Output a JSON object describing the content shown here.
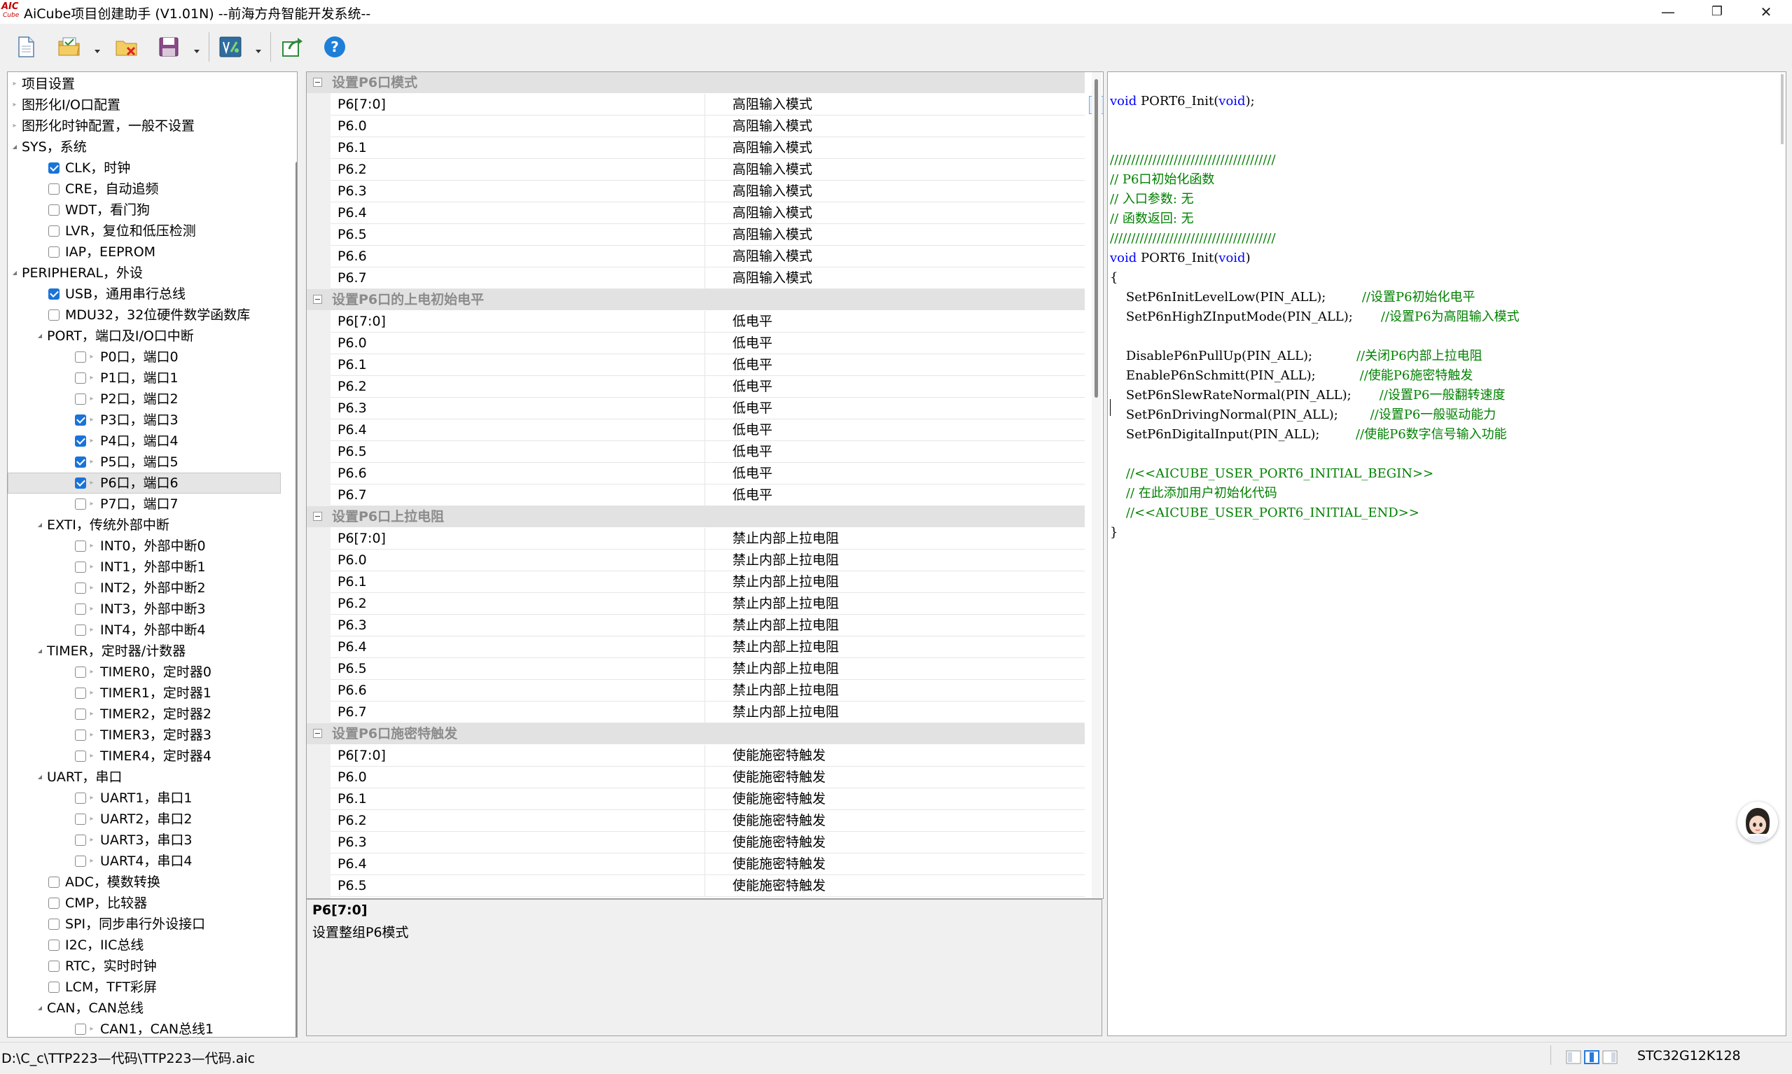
{
  "window": {
    "title": "AiCube项目创建助手 (V1.01N)   --前海方舟智能开发系统--",
    "logo_top": "AIC",
    "logo_bottom": "Cube",
    "controls": [
      "—",
      "❐",
      "✕"
    ]
  },
  "toolbar": {
    "buttons": [
      "new-project-icon",
      "open-project-icon",
      "close-project-icon",
      "save-icon",
      "generate-code-icon",
      "export-icon",
      "help-icon"
    ],
    "help_label": "?"
  },
  "tree": {
    "items": [
      {
        "label": "项目设置",
        "level": 0,
        "kind": "leaf",
        "checkbox": null
      },
      {
        "label": "图形化I/O口配置",
        "level": 0,
        "kind": "leaf",
        "checkbox": null
      },
      {
        "label": "图形化时钟配置，一般不设置",
        "level": 0,
        "kind": "leaf",
        "checkbox": null
      },
      {
        "label": "SYS，系统",
        "level": 0,
        "kind": "expanded",
        "checkbox": null
      },
      {
        "label": "CLK，时钟",
        "level": 1,
        "kind": "none",
        "checkbox": true
      },
      {
        "label": "CRE，自动追频",
        "level": 1,
        "kind": "none",
        "checkbox": false
      },
      {
        "label": "WDT，看门狗",
        "level": 1,
        "kind": "none",
        "checkbox": false
      },
      {
        "label": "LVR，复位和低压检测",
        "level": 1,
        "kind": "none",
        "checkbox": false
      },
      {
        "label": "IAP，EEPROM",
        "level": 1,
        "kind": "none",
        "checkbox": false
      },
      {
        "label": "PERIPHERAL，外设",
        "level": 0,
        "kind": "expanded",
        "checkbox": null
      },
      {
        "label": "USB，通用串行总线",
        "level": 1,
        "kind": "none",
        "checkbox": true
      },
      {
        "label": "MDU32，32位硬件数学函数库",
        "level": 1,
        "kind": "none",
        "checkbox": false
      },
      {
        "label": "PORT，端口及I/O口中断",
        "level": 1,
        "kind": "expanded",
        "checkbox": null
      },
      {
        "label": "P0口，端口0",
        "level": 2,
        "kind": "leaf",
        "checkbox": false
      },
      {
        "label": "P1口，端口1",
        "level": 2,
        "kind": "leaf",
        "checkbox": false
      },
      {
        "label": "P2口，端口2",
        "level": 2,
        "kind": "leaf",
        "checkbox": false
      },
      {
        "label": "P3口，端口3",
        "level": 2,
        "kind": "leaf",
        "checkbox": true
      },
      {
        "label": "P4口，端口4",
        "level": 2,
        "kind": "leaf",
        "checkbox": true
      },
      {
        "label": "P5口，端口5",
        "level": 2,
        "kind": "leaf",
        "checkbox": true
      },
      {
        "label": "P6口，端口6",
        "level": 2,
        "kind": "leaf",
        "checkbox": true,
        "selected": true
      },
      {
        "label": "P7口，端口7",
        "level": 2,
        "kind": "leaf",
        "checkbox": false
      },
      {
        "label": "EXTI，传统外部中断",
        "level": 1,
        "kind": "expanded",
        "checkbox": null
      },
      {
        "label": "INT0，外部中断0",
        "level": 2,
        "kind": "leaf",
        "checkbox": false
      },
      {
        "label": "INT1，外部中断1",
        "level": 2,
        "kind": "leaf",
        "checkbox": false
      },
      {
        "label": "INT2，外部中断2",
        "level": 2,
        "kind": "leaf",
        "checkbox": false
      },
      {
        "label": "INT3，外部中断3",
        "level": 2,
        "kind": "leaf",
        "checkbox": false
      },
      {
        "label": "INT4，外部中断4",
        "level": 2,
        "kind": "leaf",
        "checkbox": false
      },
      {
        "label": "TIMER，定时器/计数器",
        "level": 1,
        "kind": "expanded",
        "checkbox": null
      },
      {
        "label": "TIMER0，定时器0",
        "level": 2,
        "kind": "leaf",
        "checkbox": false
      },
      {
        "label": "TIMER1，定时器1",
        "level": 2,
        "kind": "leaf",
        "checkbox": false
      },
      {
        "label": "TIMER2，定时器2",
        "level": 2,
        "kind": "leaf",
        "checkbox": false
      },
      {
        "label": "TIMER3，定时器3",
        "level": 2,
        "kind": "leaf",
        "checkbox": false
      },
      {
        "label": "TIMER4，定时器4",
        "level": 2,
        "kind": "leaf",
        "checkbox": false
      },
      {
        "label": "UART，串口",
        "level": 1,
        "kind": "expanded",
        "checkbox": null
      },
      {
        "label": "UART1，串口1",
        "level": 2,
        "kind": "leaf",
        "checkbox": false
      },
      {
        "label": "UART2，串口2",
        "level": 2,
        "kind": "leaf",
        "checkbox": false
      },
      {
        "label": "UART3，串口3",
        "level": 2,
        "kind": "leaf",
        "checkbox": false
      },
      {
        "label": "UART4，串口4",
        "level": 2,
        "kind": "leaf",
        "checkbox": false
      },
      {
        "label": "ADC，模数转换",
        "level": 1,
        "kind": "none",
        "checkbox": false
      },
      {
        "label": "CMP，比较器",
        "level": 1,
        "kind": "none",
        "checkbox": false
      },
      {
        "label": "SPI，同步串行外设接口",
        "level": 1,
        "kind": "none",
        "checkbox": false
      },
      {
        "label": "I2C，IIC总线",
        "level": 1,
        "kind": "none",
        "checkbox": false
      },
      {
        "label": "RTC，实时时钟",
        "level": 1,
        "kind": "none",
        "checkbox": false
      },
      {
        "label": "LCM，TFT彩屏",
        "level": 1,
        "kind": "none",
        "checkbox": false
      },
      {
        "label": "CAN，CAN总线",
        "level": 1,
        "kind": "expanded",
        "checkbox": null
      },
      {
        "label": "CAN1，CAN总线1",
        "level": 2,
        "kind": "leaf",
        "checkbox": false
      }
    ]
  },
  "grid": {
    "categories": [
      {
        "title": "设置P6口模式",
        "rows": [
          {
            "name": "P6[7:0]",
            "value": "高阻输入模式",
            "selected": true
          },
          {
            "name": "P6.0",
            "value": "高阻输入模式"
          },
          {
            "name": "P6.1",
            "value": "高阻输入模式"
          },
          {
            "name": "P6.2",
            "value": "高阻输入模式"
          },
          {
            "name": "P6.3",
            "value": "高阻输入模式"
          },
          {
            "name": "P6.4",
            "value": "高阻输入模式"
          },
          {
            "name": "P6.5",
            "value": "高阻输入模式"
          },
          {
            "name": "P6.6",
            "value": "高阻输入模式"
          },
          {
            "name": "P6.7",
            "value": "高阻输入模式"
          }
        ]
      },
      {
        "title": "设置P6口的上电初始电平",
        "rows": [
          {
            "name": "P6[7:0]",
            "value": "低电平"
          },
          {
            "name": "P6.0",
            "value": "低电平"
          },
          {
            "name": "P6.1",
            "value": "低电平"
          },
          {
            "name": "P6.2",
            "value": "低电平"
          },
          {
            "name": "P6.3",
            "value": "低电平"
          },
          {
            "name": "P6.4",
            "value": "低电平"
          },
          {
            "name": "P6.5",
            "value": "低电平"
          },
          {
            "name": "P6.6",
            "value": "低电平"
          },
          {
            "name": "P6.7",
            "value": "低电平"
          }
        ]
      },
      {
        "title": "设置P6口上拉电阻",
        "rows": [
          {
            "name": "P6[7:0]",
            "value": "禁止内部上拉电阻"
          },
          {
            "name": "P6.0",
            "value": "禁止内部上拉电阻"
          },
          {
            "name": "P6.1",
            "value": "禁止内部上拉电阻"
          },
          {
            "name": "P6.2",
            "value": "禁止内部上拉电阻"
          },
          {
            "name": "P6.3",
            "value": "禁止内部上拉电阻"
          },
          {
            "name": "P6.4",
            "value": "禁止内部上拉电阻"
          },
          {
            "name": "P6.5",
            "value": "禁止内部上拉电阻"
          },
          {
            "name": "P6.6",
            "value": "禁止内部上拉电阻"
          },
          {
            "name": "P6.7",
            "value": "禁止内部上拉电阻"
          }
        ]
      },
      {
        "title": "设置P6口施密特触发",
        "rows": [
          {
            "name": "P6[7:0]",
            "value": "使能施密特触发"
          },
          {
            "name": "P6.0",
            "value": "使能施密特触发"
          },
          {
            "name": "P6.1",
            "value": "使能施密特触发"
          },
          {
            "name": "P6.2",
            "value": "使能施密特触发"
          },
          {
            "name": "P6.3",
            "value": "使能施密特触发"
          },
          {
            "name": "P6.4",
            "value": "使能施密特触发"
          },
          {
            "name": "P6.5",
            "value": "使能施密特触发"
          }
        ]
      }
    ]
  },
  "description": {
    "title": "P6[7:0]",
    "text": "设置整组P6模式"
  },
  "code": {
    "lines": [
      {
        "row": 0,
        "segs": [
          {
            "t": "void",
            "c": "kw"
          },
          {
            "t": " PORT6_Init(",
            "c": ""
          },
          {
            "t": "void",
            "c": "kw"
          },
          {
            "t": ");",
            "c": ""
          }
        ]
      },
      {
        "row": 3,
        "segs": [
          {
            "t": "///////////////////////////////////////",
            "c": "cm"
          }
        ]
      },
      {
        "row": 4,
        "segs": [
          {
            "t": "// P6口初始化函数",
            "c": "cm"
          }
        ]
      },
      {
        "row": 5,
        "segs": [
          {
            "t": "// 入口参数: 无",
            "c": "cm"
          }
        ]
      },
      {
        "row": 6,
        "segs": [
          {
            "t": "// 函数返回: 无",
            "c": "cm"
          }
        ]
      },
      {
        "row": 7,
        "segs": [
          {
            "t": "///////////////////////////////////////",
            "c": "cm"
          }
        ]
      },
      {
        "row": 8,
        "segs": [
          {
            "t": "void",
            "c": "kw"
          },
          {
            "t": " PORT6_Init(",
            "c": ""
          },
          {
            "t": "void",
            "c": "kw"
          },
          {
            "t": ")",
            "c": ""
          }
        ]
      },
      {
        "row": 9,
        "segs": [
          {
            "t": "{",
            "c": ""
          }
        ]
      },
      {
        "row": 10,
        "segs": [
          {
            "t": "    SetP6nInitLevelLow(PIN_ALL);         ",
            "c": ""
          },
          {
            "t": "//设置P6初始化电平",
            "c": "cm"
          }
        ]
      },
      {
        "row": 11,
        "segs": [
          {
            "t": "    SetP6nHighZInputMode(PIN_ALL);       ",
            "c": ""
          },
          {
            "t": "//设置P6为高阻输入模式",
            "c": "cm"
          }
        ]
      },
      {
        "row": 13,
        "segs": [
          {
            "t": "    DisableP6nPullUp(PIN_ALL);           ",
            "c": ""
          },
          {
            "t": "//关闭P6内部上拉电阻",
            "c": "cm"
          }
        ]
      },
      {
        "row": 14,
        "segs": [
          {
            "t": "    EnableP6nSchmitt(PIN_ALL);           ",
            "c": ""
          },
          {
            "t": "//使能P6施密特触发",
            "c": "cm"
          }
        ]
      },
      {
        "row": 15,
        "segs": [
          {
            "t": "    SetP6nSlewRateNormal(PIN_ALL);       ",
            "c": ""
          },
          {
            "t": "//设置P6一般翻转速度",
            "c": "cm"
          }
        ]
      },
      {
        "row": 16,
        "segs": [
          {
            "t": "    SetP6nDrivingNormal(PIN_ALL);        ",
            "c": ""
          },
          {
            "t": "//设置P6一般驱动能力",
            "c": "cm"
          }
        ]
      },
      {
        "row": 17,
        "segs": [
          {
            "t": "    SetP6nDigitalInput(PIN_ALL);         ",
            "c": ""
          },
          {
            "t": "//使能P6数字信号输入功能",
            "c": "cm"
          }
        ]
      },
      {
        "row": 19,
        "segs": [
          {
            "t": "    //<<AICUBE_USER_PORT6_INITIAL_BEGIN>>",
            "c": "cm"
          }
        ]
      },
      {
        "row": 20,
        "segs": [
          {
            "t": "    // 在此添加用户初始化代码",
            "c": "cm"
          }
        ]
      },
      {
        "row": 21,
        "segs": [
          {
            "t": "    //<<AICUBE_USER_PORT6_INITIAL_END>>",
            "c": "cm"
          }
        ]
      },
      {
        "row": 22,
        "segs": [
          {
            "t": "}",
            "c": ""
          }
        ]
      }
    ]
  },
  "status": {
    "path": "D:\\C_c\\TTP223—代码\\TTP223—代码.aic",
    "chip": "STC32G12K128"
  },
  "colors": {
    "keyword": "#0000ff",
    "comment": "#008000",
    "checkbox_on": "#1a73d9",
    "category_text": "#8c8c8c"
  }
}
